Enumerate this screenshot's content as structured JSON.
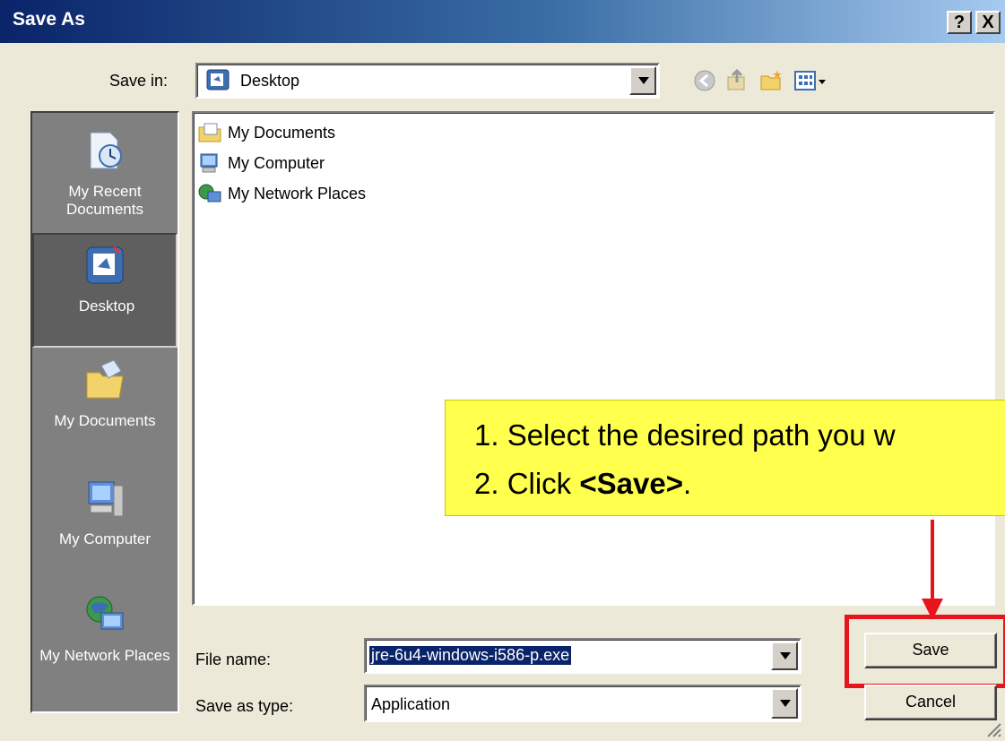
{
  "window": {
    "title": "Save As",
    "help_glyph": "?",
    "close_glyph": "X"
  },
  "savein": {
    "label": "Save in:",
    "value": "Desktop",
    "value_icon": "desktop-icon"
  },
  "toolbar": {
    "icons": [
      "back-icon",
      "up-folder-icon",
      "new-folder-icon",
      "view-menu-icon"
    ]
  },
  "places": [
    {
      "label": "My Recent Documents",
      "icon": "recent-documents-icon"
    },
    {
      "label": "Desktop",
      "icon": "desktop-icon",
      "selected": true
    },
    {
      "label": "My Documents",
      "icon": "my-documents-icon"
    },
    {
      "label": "My Computer",
      "icon": "my-computer-icon"
    },
    {
      "label": "My Network Places",
      "icon": "network-places-icon"
    }
  ],
  "files": [
    {
      "name": "My Documents",
      "icon": "folder-documents-icon"
    },
    {
      "name": "My Computer",
      "icon": "computer-icon"
    },
    {
      "name": "My Network Places",
      "icon": "network-icon"
    }
  ],
  "callout": {
    "line1": "1. Select the desired path you w",
    "line2_prefix": "2. Click ",
    "line2_bold": "<Save>",
    "line2_suffix": "."
  },
  "form": {
    "filename_label": "File name:",
    "filename_value": "jre-6u4-windows-i586-p.exe",
    "savetype_label": "Save as type:",
    "savetype_value": "Application"
  },
  "buttons": {
    "save": "Save",
    "cancel": "Cancel"
  },
  "colors": {
    "callout": "#ffff4d",
    "highlight": "#e8141b",
    "titlebar": "#0a246a"
  }
}
